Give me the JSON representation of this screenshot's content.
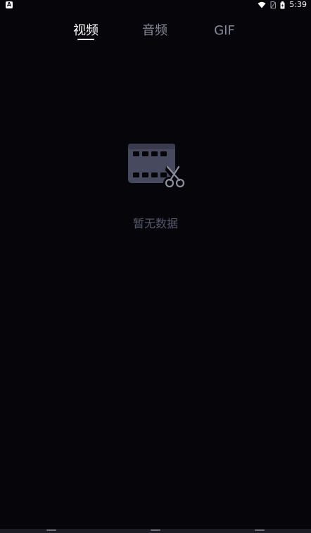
{
  "status_bar": {
    "left_badge": "A",
    "time": "5:39",
    "icons": [
      "wifi-icon",
      "sim-icon",
      "battery-icon"
    ]
  },
  "tabs": [
    {
      "label": "视频",
      "active": true
    },
    {
      "label": "音频",
      "active": false
    },
    {
      "label": "GIF",
      "active": false
    }
  ],
  "empty_state": {
    "icon": "film-scissors-icon",
    "message": "暂无数据"
  },
  "colors": {
    "background": "#05050a",
    "tab_active": "#ffffff",
    "tab_inactive": "#8a8b9a",
    "empty_text": "#55566a",
    "illustration": "#474a5e"
  }
}
